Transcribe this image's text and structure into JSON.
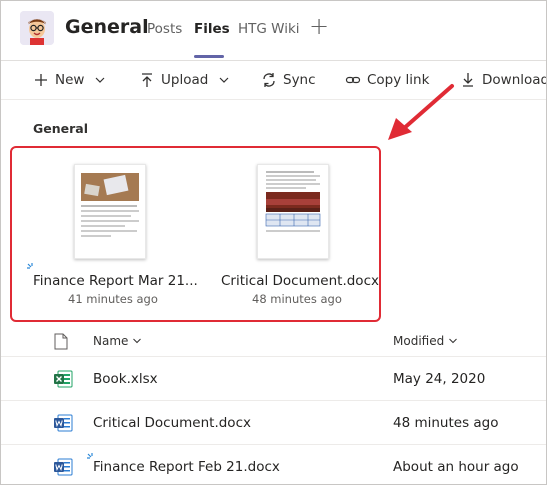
{
  "header": {
    "title": "General",
    "tabs": [
      {
        "label": "Posts",
        "active": false
      },
      {
        "label": "Files",
        "active": true
      },
      {
        "label": "HTG Wiki",
        "active": false
      }
    ],
    "add_tab_label": "+"
  },
  "toolbar": {
    "new_label": "New",
    "upload_label": "Upload",
    "sync_label": "Sync",
    "copy_link_label": "Copy link",
    "download_label": "Download"
  },
  "section": {
    "title": "General"
  },
  "recent_files": [
    {
      "name": "Finance Report Mar 21...",
      "time": "41 minutes ago",
      "syncing": true
    },
    {
      "name": "Critical Document.docx",
      "time": "48 minutes ago",
      "syncing": false
    }
  ],
  "list": {
    "columns": {
      "name": "Name",
      "modified": "Modified"
    },
    "rows": [
      {
        "name": "Book.xlsx",
        "modified": "May 24, 2020",
        "icon": "excel-file-icon"
      },
      {
        "name": "Critical Document.docx",
        "modified": "48 minutes ago",
        "icon": "word-file-icon"
      },
      {
        "name": "Finance Report Feb 21.docx",
        "modified": "About an hour ago",
        "icon": "word-file-icon"
      }
    ]
  },
  "colors": {
    "accent": "#6264a7",
    "highlight": "#e02b35",
    "excel": "#217346",
    "word": "#2b579a"
  }
}
